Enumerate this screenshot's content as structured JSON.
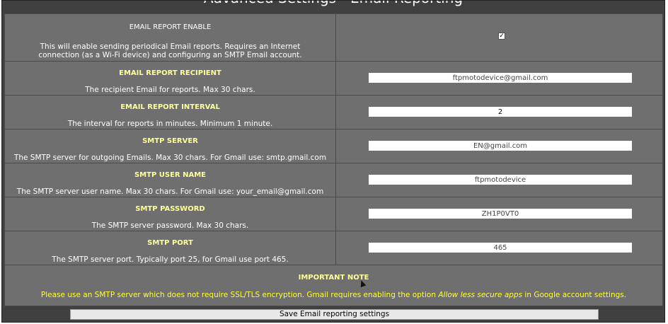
{
  "page": {
    "title": "Advanced Settings - Email Reporting"
  },
  "settings": [
    {
      "label": "EMAIL REPORT ENABLE",
      "description": "This will enable sending periodical Email reports. Requires an Internet connection (as a Wi-Fi device) and configuring an SMTP Email account.",
      "checked": true
    },
    {
      "label": "EMAIL REPORT RECIPIENT",
      "description": "The recipient Email for reports. Max 30 chars.",
      "value": "ftpmotodevice@gmail.com"
    },
    {
      "label": "EMAIL REPORT INTERVAL",
      "description": "The interval for reports in minutes. Minimum 1 minute.",
      "value": "2"
    },
    {
      "label": "SMTP SERVER",
      "description": "The SMTP server for outgoing Emails. Max 30 chars. For Gmail use: smtp.gmail.com",
      "value": "EN@gmail.com"
    },
    {
      "label": "SMTP USER NAME",
      "description": "The SMTP server user name. Max 30 chars. For Gmail use: your_email@gmail.com",
      "value": "ftpmotodevice"
    },
    {
      "label": "SMTP PASSWORD",
      "description": "The SMTP server password. Max 30 chars.",
      "value": "ZH1P0VT0"
    },
    {
      "label": "SMTP PORT",
      "description": "The SMTP server port. Typically port 25, for Gmail use port 465.",
      "value": "465"
    }
  ],
  "note": {
    "title": "IMPORTANT NOTE",
    "text_before": "Please use an SMTP server which does not require SSL/TLS encryption. Gmail requires enabling the option ",
    "text_em": "Allow less secure apps",
    "text_after": " in Google account settings."
  },
  "save_button": {
    "label": "Save Email reporting settings"
  },
  "colors": {
    "panel": "#6f6f6f",
    "background": "#404040",
    "label_yellow": "#ffff99",
    "note_yellow": "#ffff33"
  }
}
